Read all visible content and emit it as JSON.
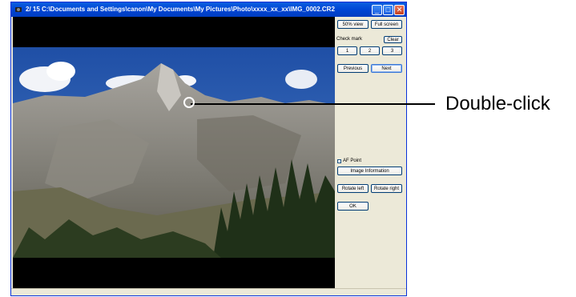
{
  "window": {
    "title": "2/ 15  C:\\Documents and Settings\\canon\\My Documents\\My Pictures\\Photo\\xxxx_xx_xx\\IMG_0002.CR2",
    "buttons": {
      "minimize": "_",
      "maximize": "□",
      "close": "✕"
    }
  },
  "panel": {
    "view_50": "50% view",
    "full_screen": "Full screen",
    "check_mark_label": "Check mark",
    "clear": "Clear",
    "check_1": "1",
    "check_2": "2",
    "check_3": "3",
    "previous": "Previous",
    "next": "Next",
    "af_point": "AF Point",
    "image_information": "Image Information",
    "rotate_left": "Rotate left",
    "rotate_right": "Rotate right",
    "ok": "OK"
  },
  "callout": {
    "text": "Double-click"
  },
  "colors": {
    "titlebar": "#0046d5",
    "panel": "#ece9d8",
    "viewer_bg": "#000000"
  },
  "icons": [
    "app-icon",
    "minimize-icon",
    "maximize-icon",
    "close-icon",
    "pointer-circle-icon"
  ]
}
